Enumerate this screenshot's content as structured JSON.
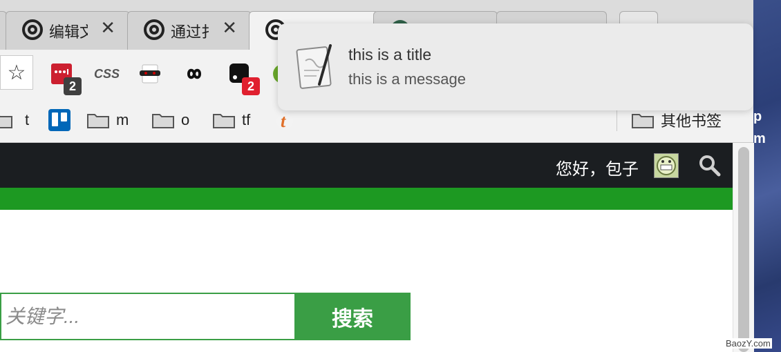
{
  "tabs": [
    {
      "label": "",
      "active": false
    },
    {
      "label": "编辑文",
      "active": false
    },
    {
      "label": "通过扌",
      "active": false
    },
    {
      "label": "",
      "active": true
    },
    {
      "label": "",
      "active": false
    },
    {
      "label": "",
      "active": false
    }
  ],
  "toolbar": {
    "bookmark_star": "☆",
    "extensions": [
      {
        "icon": "lastpass-icon",
        "badge": "2"
      },
      {
        "icon": "css-icon",
        "text": "CSS"
      },
      {
        "icon": "incognito-mask-icon"
      },
      {
        "icon": "infinity-loop-icon"
      },
      {
        "icon": "black-app-icon",
        "badge": "2"
      },
      {
        "icon": "green-circle-icon"
      }
    ]
  },
  "bookmarks": {
    "items": [
      {
        "label": "",
        "icon": "folder-icon"
      },
      {
        "label": "t",
        "icon": "none"
      },
      {
        "label": "",
        "icon": "trello-icon"
      },
      {
        "label": "m",
        "icon": "folder-icon"
      },
      {
        "label": "o",
        "icon": "folder-icon"
      },
      {
        "label": "tf",
        "icon": "folder-icon"
      },
      {
        "label": "",
        "icon": "t-feed-icon"
      }
    ],
    "other": "其他书签"
  },
  "notification": {
    "title": "this is a title",
    "message": "this is a message",
    "icon": "script-editor-icon"
  },
  "site": {
    "greeting": "您好，包子",
    "search_placeholder": "关键字...",
    "search_button": "搜索",
    "accent_green": "#1d9922",
    "button_green": "#3a9e45",
    "nav_bg": "#1b1e21"
  },
  "desktop": {
    "fragment_1": "p",
    "fragment_2": "m"
  },
  "watermark": "BaozY.com"
}
